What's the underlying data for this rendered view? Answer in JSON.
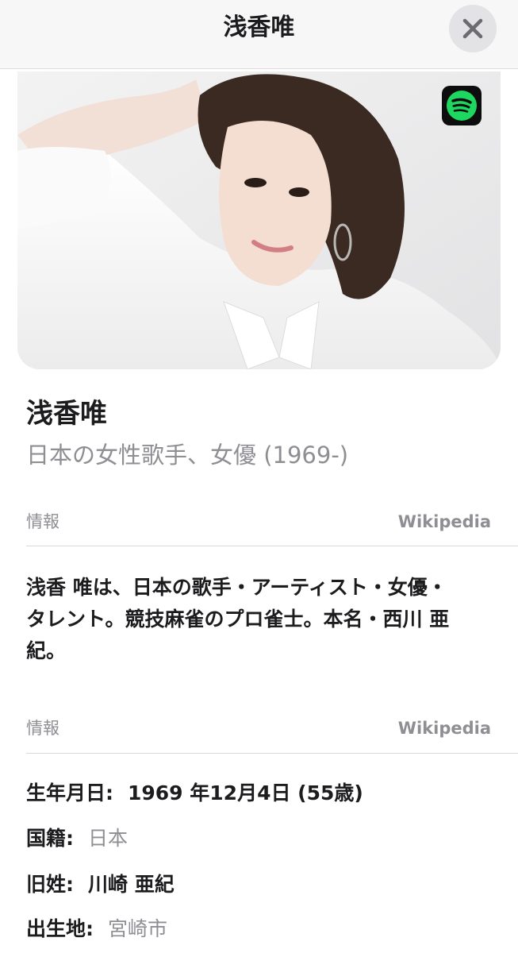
{
  "topbar": {
    "title": "浅香唯"
  },
  "hero": {
    "badge_icon": "spotify-icon",
    "badge_color": "#1ed760"
  },
  "profile": {
    "name": "浅香唯",
    "subtitle": "日本の女性歌手、女優 (1969-)"
  },
  "section1": {
    "label": "情報",
    "source": "Wikipedia",
    "summary": "浅香 唯は、日本の歌手・アーティスト・女優・タレント。競技麻雀のプロ雀士。本名・西川 亜紀。"
  },
  "section2": {
    "label": "情報",
    "source": "Wikipedia",
    "facts": [
      {
        "key": "生年月日:",
        "value": "1969 年12月4日 (55歳)"
      },
      {
        "key": "国籍:",
        "value": "日本"
      },
      {
        "key": "旧姓:",
        "value": "川崎 亜紀"
      },
      {
        "key": "出生地:",
        "value": "宮崎市"
      }
    ]
  }
}
